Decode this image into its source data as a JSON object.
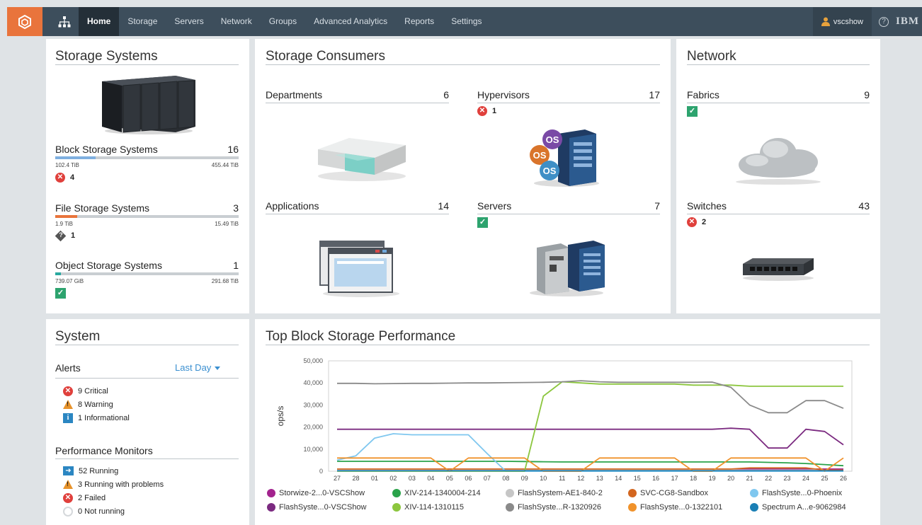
{
  "nav": {
    "items": [
      "Home",
      "Storage",
      "Servers",
      "Network",
      "Groups",
      "Advanced Analytics",
      "Reports",
      "Settings"
    ],
    "active": "Home",
    "user": "vscshow",
    "brand": "IBM",
    "help": "?"
  },
  "storage_systems": {
    "title": "Storage Systems",
    "block": {
      "label": "Block Storage Systems",
      "count": "16",
      "used": "102.4 TiB",
      "total": "455.44 TiB",
      "fill": 0.22,
      "status": "4",
      "bar_color": "#7fb0e0"
    },
    "file": {
      "label": "File Storage Systems",
      "count": "3",
      "used": "1.9 TiB",
      "total": "15.49 TiB",
      "fill": 0.12,
      "status": "1",
      "bar_color": "#e9743c"
    },
    "object": {
      "label": "Object Storage Systems",
      "count": "1",
      "used": "739.07 GiB",
      "total": "291.68 TiB",
      "fill": 0.03,
      "bar_color": "#2aa9a0"
    }
  },
  "consumers": {
    "title": "Storage Consumers",
    "departments": {
      "label": "Departments",
      "count": "6"
    },
    "hypervisors": {
      "label": "Hypervisors",
      "count": "17",
      "status": "1"
    },
    "applications": {
      "label": "Applications",
      "count": "14"
    },
    "servers": {
      "label": "Servers",
      "count": "7"
    }
  },
  "network": {
    "title": "Network",
    "fabrics": {
      "label": "Fabrics",
      "count": "9"
    },
    "switches": {
      "label": "Switches",
      "count": "43",
      "status": "2"
    }
  },
  "system": {
    "title": "System",
    "alerts_label": "Alerts",
    "range": "Last Day",
    "alerts": [
      {
        "icon": "critical-icon",
        "text": "9 Critical"
      },
      {
        "icon": "warning-icon",
        "text": "8 Warning"
      },
      {
        "icon": "info-icon",
        "text": "1 Informational"
      }
    ],
    "monitors_label": "Performance Monitors",
    "monitors": [
      {
        "icon": "running-icon",
        "text": "52 Running"
      },
      {
        "icon": "warning-icon",
        "text": "3 Running with problems"
      },
      {
        "icon": "failed-icon",
        "text": "2 Failed"
      },
      {
        "icon": "not-running-icon",
        "text": "0 Not running"
      }
    ]
  },
  "performance": {
    "title": "Top Block Storage Performance"
  },
  "chart_data": {
    "type": "line",
    "title": "Top Block Storage Performance",
    "ylabel": "ops/s",
    "ylim": [
      0,
      50000
    ],
    "yticks": [
      "0",
      "10,000",
      "20,000",
      "30,000",
      "40,000",
      "50,000"
    ],
    "x": [
      "27",
      "28",
      "01",
      "02",
      "03",
      "04",
      "05",
      "06",
      "07",
      "08",
      "09",
      "10",
      "11",
      "12",
      "13",
      "14",
      "15",
      "16",
      "17",
      "18",
      "19",
      "20",
      "21",
      "22",
      "23",
      "24",
      "25",
      "26"
    ],
    "grid": false,
    "legend": "bottom",
    "series": [
      {
        "name": "Storwize-2...0-VSCShow",
        "color": "#a3238e",
        "values": [
          1000,
          1000,
          1000,
          1000,
          1000,
          1000,
          1000,
          1000,
          1000,
          1000,
          1000,
          1000,
          1000,
          1000,
          1000,
          1000,
          1000,
          1000,
          1000,
          1000,
          1000,
          1000,
          1000,
          1000,
          1000,
          1000,
          1000,
          1000
        ]
      },
      {
        "name": "XIV-214-1340004-214",
        "color": "#2aa34a",
        "values": [
          4500,
          4500,
          4500,
          4500,
          4500,
          4500,
          4500,
          4500,
          4500,
          4500,
          4400,
          4300,
          4200,
          4200,
          4200,
          4200,
          4200,
          4200,
          4200,
          4200,
          4200,
          4200,
          4200,
          4000,
          3800,
          3500,
          3000,
          2500
        ]
      },
      {
        "name": "FlashSystem-AE1-840-2",
        "color": "#c6c6c6",
        "values": [
          500,
          500,
          500,
          500,
          500,
          500,
          500,
          500,
          500,
          500,
          500,
          500,
          500,
          500,
          500,
          500,
          500,
          500,
          500,
          500,
          500,
          500,
          500,
          500,
          500,
          500,
          500,
          500
        ]
      },
      {
        "name": "SVC-CG8-Sandbox",
        "color": "#d3661f",
        "values": [
          1000,
          1000,
          1000,
          1000,
          1000,
          1000,
          1000,
          1000,
          1000,
          1000,
          1000,
          1000,
          1000,
          1000,
          1000,
          1000,
          1000,
          1000,
          1000,
          1000,
          1000,
          1000,
          1500,
          1500,
          1500,
          1500,
          500,
          500
        ]
      },
      {
        "name": "FlashSyste...0-Phoenix",
        "color": "#7fc7ef",
        "values": [
          5000,
          7000,
          15000,
          17000,
          16500,
          16500,
          16500,
          16500,
          8000,
          0,
          0,
          0,
          0,
          0,
          0,
          0,
          0,
          0,
          0,
          0,
          0,
          0,
          0,
          0,
          0,
          0,
          0,
          0
        ]
      },
      {
        "name": "FlashSyste...0-VSCShow",
        "color": "#7b2a80",
        "values": [
          19000,
          19000,
          19000,
          19000,
          19000,
          19000,
          19000,
          19000,
          19000,
          19000,
          19000,
          19000,
          19000,
          19000,
          19000,
          19000,
          19000,
          19000,
          19000,
          19000,
          19000,
          19500,
          19000,
          10500,
          10500,
          19000,
          18000,
          12000
        ]
      },
      {
        "name": "XIV-114-1310115",
        "color": "#8cc63e",
        "values": [
          0,
          0,
          0,
          0,
          0,
          0,
          0,
          0,
          0,
          0,
          0,
          34000,
          40500,
          40000,
          39500,
          39500,
          39500,
          39500,
          39500,
          39000,
          39000,
          39000,
          38500,
          38500,
          38500,
          38500,
          38500,
          38500
        ]
      },
      {
        "name": "FlashSyste...R-1320926",
        "color": "#8a8a8a",
        "values": [
          39800,
          39800,
          39600,
          39700,
          39800,
          39800,
          39900,
          40000,
          40000,
          40100,
          40200,
          40300,
          40500,
          41000,
          40500,
          40300,
          40300,
          40300,
          40300,
          40300,
          40400,
          38000,
          30000,
          26500,
          26500,
          32000,
          32000,
          28500
        ]
      },
      {
        "name": "FlashSyste...0-1322101",
        "color": "#f0922b",
        "values": [
          6000,
          6000,
          6000,
          6000,
          6000,
          6000,
          0,
          6000,
          6000,
          6000,
          6000,
          0,
          0,
          0,
          6000,
          6000,
          6000,
          6000,
          6000,
          0,
          0,
          6000,
          6000,
          6000,
          6000,
          6000,
          0,
          6000
        ]
      },
      {
        "name": "Spectrum A...e-9062984",
        "color": "#1a7fb5",
        "values": [
          200,
          200,
          200,
          200,
          200,
          200,
          200,
          200,
          200,
          200,
          200,
          200,
          200,
          200,
          200,
          200,
          200,
          200,
          200,
          200,
          200,
          200,
          200,
          200,
          200,
          200,
          200,
          200
        ]
      }
    ]
  }
}
